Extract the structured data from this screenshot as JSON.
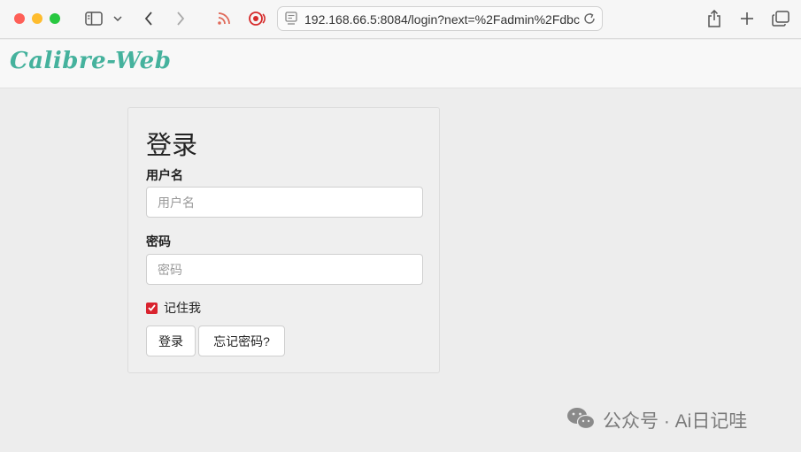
{
  "browser": {
    "url": "192.168.66.5:8084/login?next=%2Fadmin%2Fdbc"
  },
  "app": {
    "brand": "Calibre-Web"
  },
  "login": {
    "title": "登录",
    "username_label": "用户名",
    "username_placeholder": "用户名",
    "password_label": "密码",
    "password_placeholder": "密码",
    "remember_label": "记住我",
    "remember_checked": true,
    "submit_label": "登录",
    "forgot_label": "忘记密码?"
  },
  "watermark": {
    "text": "公众号 · Ai日记哇"
  },
  "colors": {
    "brand": "#45b29d",
    "checkbox": "#d9232e",
    "rss": "#e06a5a",
    "record": "#d62a2a"
  },
  "icons": [
    "sidebar-icon",
    "chevron-down-icon",
    "back-icon",
    "forward-icon",
    "rss-icon",
    "record-icon",
    "page-icon",
    "reload-icon",
    "share-icon",
    "plus-icon",
    "tabs-icon",
    "wechat-icon"
  ]
}
